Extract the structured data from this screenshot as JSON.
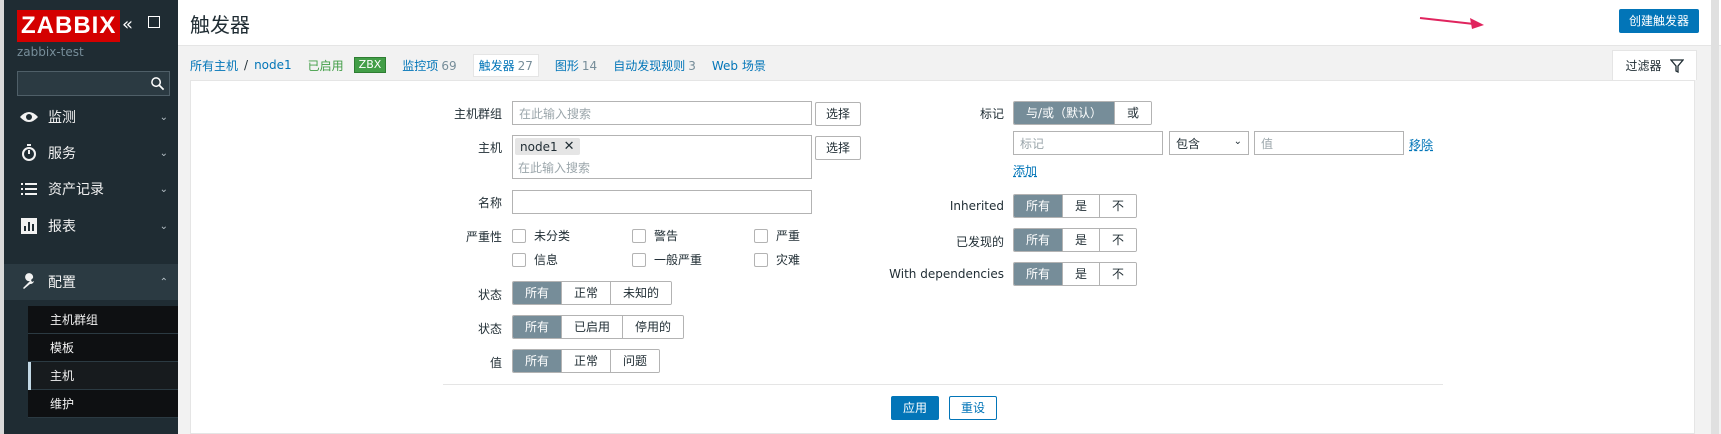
{
  "sidebar": {
    "logo": "ZABBIX",
    "server_name": "zabbix-test",
    "search_placeholder": "",
    "menu": [
      {
        "label": "监测",
        "icon": "eye-icon"
      },
      {
        "label": "服务",
        "icon": "stopwatch-icon"
      },
      {
        "label": "资产记录",
        "icon": "list-icon"
      },
      {
        "label": "报表",
        "icon": "bar-chart-icon"
      },
      {
        "label": "配置",
        "icon": "wrench-icon"
      }
    ],
    "submenu": [
      "主机群组",
      "模板",
      "主机",
      "维护"
    ]
  },
  "header": {
    "title": "触发器",
    "create_button": "创建触发器"
  },
  "breadcrumb": {
    "all_hosts": "所有主机",
    "separator": "/",
    "host": "node1",
    "enabled": "已启用",
    "zbx": "ZBX",
    "items_label": "监控项",
    "items_count": "69",
    "triggers_label": "触发器",
    "triggers_count": "27",
    "graphs_label": "图形",
    "graphs_count": "14",
    "discovery_label": "自动发现规则",
    "discovery_count": "3",
    "web_label": "Web 场景"
  },
  "filter": {
    "tab_label": "过滤器",
    "host_group_label": "主机群组",
    "host_group_placeholder": "在此输入搜索",
    "select_button": "选择",
    "host_label": "主机",
    "host_tag": "node1",
    "host_placeholder": "在此输入搜索",
    "name_label": "名称",
    "severity_label": "严重性",
    "severities": [
      "未分类",
      "警告",
      "严重",
      "信息",
      "一般严重",
      "灾难"
    ],
    "state_label": "状态",
    "state_options": [
      "所有",
      "正常",
      "未知的"
    ],
    "status_label": "状态",
    "status_options": [
      "所有",
      "已启用",
      "停用的"
    ],
    "value_label": "值",
    "value_options": [
      "所有",
      "正常",
      "问题"
    ],
    "tags_label": "标记",
    "tags_mode": [
      "与/或（默认）",
      "或"
    ],
    "tag_placeholder": "标记",
    "tag_operator": "包含",
    "tag_value_placeholder": "值",
    "remove_link": "移除",
    "add_link": "添加",
    "inherited_label": "Inherited",
    "discovered_label": "已发现的",
    "dependencies_label": "With dependencies",
    "tri_options": [
      "所有",
      "是",
      "不"
    ],
    "apply_button": "应用",
    "reset_button": "重设"
  }
}
